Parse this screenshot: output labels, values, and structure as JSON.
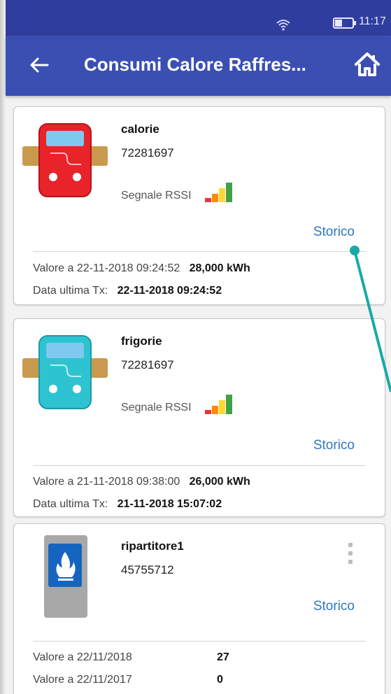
{
  "status_bar": {
    "time": "11:17"
  },
  "app_bar": {
    "title": "Consumi Calore Raffres..."
  },
  "cards": [
    {
      "name": "calorie",
      "serial": "72281697",
      "rssi_label": "Segnale RSSI",
      "link": "Storico",
      "value_label": "Valore a 22-11-2018 09:24:52",
      "value": "28,000 kWh",
      "tx_label": "Data ultima Tx:",
      "tx_value": "22-11-2018 09:24:52"
    },
    {
      "name": "frigorie",
      "serial": "72281697",
      "rssi_label": "Segnale RSSI",
      "link": "Storico",
      "value_label": "Valore a 21-11-2018 09:38:00",
      "value": "26,000 kWh",
      "tx_label": "Data ultima Tx:",
      "tx_value": "21-11-2018 15:07:02"
    },
    {
      "name": "ripartitore1",
      "serial": "45755712",
      "link": "Storico",
      "rows": [
        {
          "label": "Valore a 22/11/2018",
          "value": "27"
        },
        {
          "label": "Valore a 22/11/2017",
          "value": "0"
        }
      ]
    }
  ],
  "colors": {
    "status_bar": "#2f3e9e",
    "app_bar": "#3b4fb3",
    "link": "#2d78c4",
    "heat_meter": "#e8232a",
    "cool_meter": "#2ec3d1",
    "callout": "#1aa9a9"
  },
  "icons": [
    "wifi-icon",
    "battery-icon",
    "back-arrow-icon",
    "home-icon",
    "heat-meter-icon",
    "cool-meter-icon",
    "signal-bars-icon",
    "flame-icon",
    "more-vert-icon"
  ]
}
